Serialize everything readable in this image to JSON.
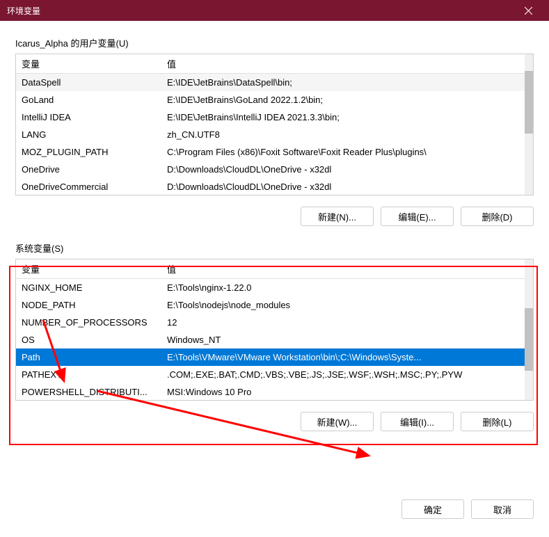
{
  "window": {
    "title": "环境变量"
  },
  "user_section": {
    "label": "Icarus_Alpha 的用户变量(U)",
    "headers": {
      "variable": "变量",
      "value": "值"
    },
    "rows": [
      {
        "name": "DataSpell",
        "value": "E:\\IDE\\JetBrains\\DataSpell\\bin;"
      },
      {
        "name": "GoLand",
        "value": "E:\\IDE\\JetBrains\\GoLand 2022.1.2\\bin;"
      },
      {
        "name": "IntelliJ IDEA",
        "value": "E:\\IDE\\JetBrains\\IntelliJ IDEA 2021.3.3\\bin;"
      },
      {
        "name": "LANG",
        "value": "zh_CN.UTF8"
      },
      {
        "name": "MOZ_PLUGIN_PATH",
        "value": "C:\\Program Files (x86)\\Foxit Software\\Foxit Reader Plus\\plugins\\"
      },
      {
        "name": "OneDrive",
        "value": "D:\\Downloads\\CloudDL\\OneDrive - x32dl"
      },
      {
        "name": "OneDriveCommercial",
        "value": "D:\\Downloads\\CloudDL\\OneDrive - x32dl"
      }
    ],
    "buttons": {
      "new": "新建(N)...",
      "edit": "编辑(E)...",
      "delete": "删除(D)"
    }
  },
  "system_section": {
    "label": "系统变量(S)",
    "headers": {
      "variable": "变量",
      "value": "值"
    },
    "rows": [
      {
        "name": "NGINX_HOME",
        "value": "E:\\Tools\\nginx-1.22.0"
      },
      {
        "name": "NODE_PATH",
        "value": "E:\\Tools\\nodejs\\node_modules"
      },
      {
        "name": "NUMBER_OF_PROCESSORS",
        "value": "12"
      },
      {
        "name": "OS",
        "value": "Windows_NT"
      },
      {
        "name": "Path",
        "value": "E:\\Tools\\VMware\\VMware Workstation\\bin\\;C:\\Windows\\Syste...",
        "selected": true
      },
      {
        "name": "PATHEXT",
        "value": ".COM;.EXE;.BAT;.CMD;.VBS;.VBE;.JS;.JSE;.WSF;.WSH;.MSC;.PY;.PYW"
      },
      {
        "name": "POWERSHELL_DISTRIBUTI...",
        "value": "MSI:Windows 10 Pro"
      }
    ],
    "buttons": {
      "new": "新建(W)...",
      "edit": "编辑(I)...",
      "delete": "删除(L)"
    }
  },
  "footer": {
    "ok": "确定",
    "cancel": "取消"
  }
}
